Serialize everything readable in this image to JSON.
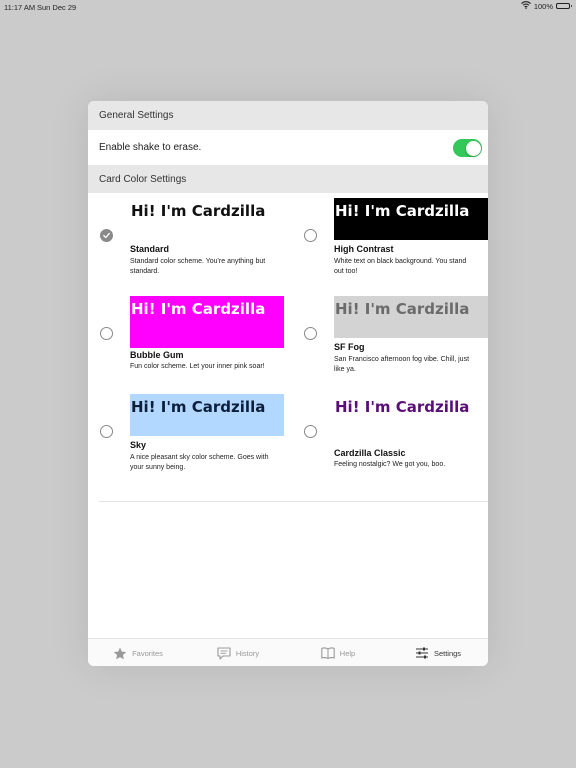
{
  "status_bar": {
    "time": "11:17 AM",
    "date": "Sun Dec 29",
    "battery": "100%",
    "icons": [
      "wifi-icon",
      "battery-icon"
    ]
  },
  "general_settings": {
    "header": "General Settings",
    "shake_label": "Enable shake to erase.",
    "shake_enabled": true
  },
  "card_color_settings": {
    "header": "Card Color Settings",
    "options": [
      {
        "preview_text": "Hi! I'm Cardzilla",
        "title": "Standard",
        "description": "Standard color scheme. You're anything but standard.",
        "selected": true,
        "bg": "#ffffff",
        "fg": "#111111"
      },
      {
        "preview_text": "Hi! I'm Cardzilla",
        "title": "High Contrast",
        "description": "White text on black background. You stand out too!",
        "selected": false,
        "bg": "#000000",
        "fg": "#ffffff"
      },
      {
        "preview_text": "Hi! I'm Cardzilla",
        "title": "Bubble Gum",
        "description": "Fun color scheme. Let your inner pink soar!",
        "selected": false,
        "bg": "#ff00ff",
        "fg": "#ffffff"
      },
      {
        "preview_text": "Hi! I'm Cardzilla",
        "title": "SF Fog",
        "description": "San Francisco afternoon fog vibe. Chill, just like ya.",
        "selected": false,
        "bg": "#d3d3d3",
        "fg": "#6b6b6b"
      },
      {
        "preview_text": "Hi! I'm Cardzilla",
        "title": "Sky",
        "description": "A nice pleasant sky color scheme. Goes with your sunny being.",
        "selected": false,
        "bg": "#b3d8ff",
        "fg": "#0d1f3a"
      },
      {
        "preview_text": "Hi! I'm Cardzilla",
        "title": "Cardzilla Classic",
        "description": "Feeling nostalgic? We got you, boo.",
        "selected": false,
        "bg": "#ffffff",
        "fg": "#5a0f78"
      }
    ]
  },
  "tab_bar": {
    "tabs": [
      {
        "label": "Favorites",
        "icon": "star-icon",
        "active": false
      },
      {
        "label": "History",
        "icon": "speech-bubble-icon",
        "active": false
      },
      {
        "label": "Help",
        "icon": "book-icon",
        "active": false
      },
      {
        "label": "Settings",
        "icon": "sliders-icon",
        "active": true
      }
    ]
  }
}
